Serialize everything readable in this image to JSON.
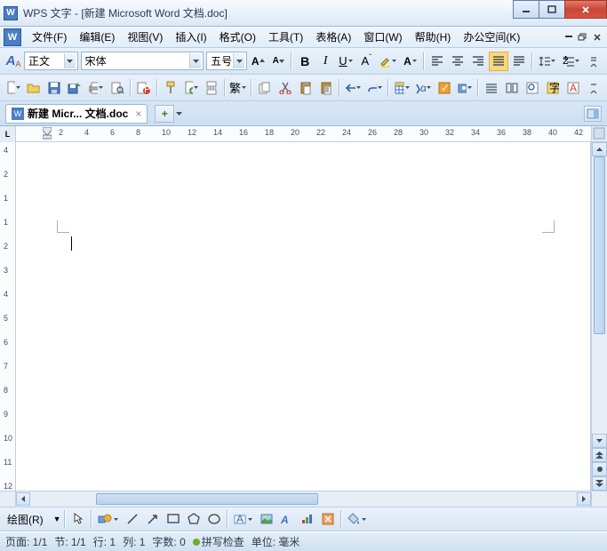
{
  "title": "WPS 文字 - [新建 Microsoft Word 文档.doc]",
  "menus": {
    "file": "文件(F)",
    "edit": "编辑(E)",
    "view": "视图(V)",
    "insert": "插入(I)",
    "format": "格式(O)",
    "tools": "工具(T)",
    "table": "表格(A)",
    "window": "窗口(W)",
    "help": "帮助(H)",
    "office": "办公空间(K)"
  },
  "format_tb": {
    "style_icon": "A",
    "style": "正文",
    "font": "宋体",
    "size": "五号"
  },
  "doc_tab": {
    "name": "新建 Micr... 文档.doc"
  },
  "hruler": [
    2,
    4,
    6,
    8,
    10,
    12,
    14,
    16,
    18,
    20,
    22,
    24,
    26,
    28,
    30,
    32,
    34,
    36,
    38,
    40,
    42
  ],
  "vruler": [
    4,
    2,
    1,
    1,
    2,
    3,
    4,
    5,
    6,
    7,
    8,
    9,
    10,
    11,
    12
  ],
  "draw_label": "绘图(R)",
  "status": {
    "page": "页面: 1/1",
    "section": "节: 1/1",
    "line": "行: 1",
    "col": "列: 1",
    "chars": "字数: 0",
    "spell": "拼写检查",
    "unit": "单位: 毫米"
  }
}
